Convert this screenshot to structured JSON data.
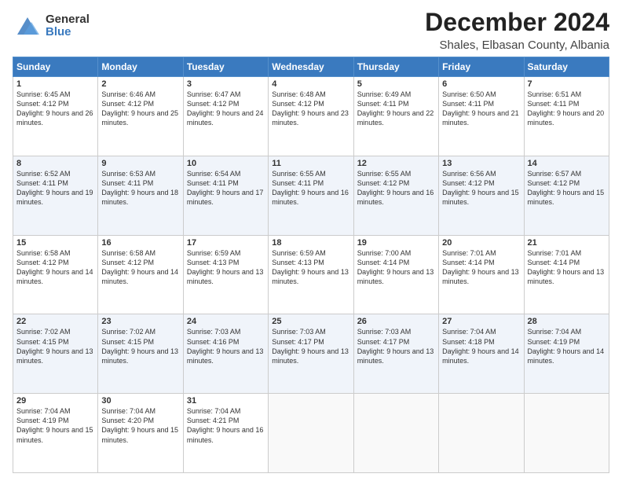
{
  "header": {
    "logo_general": "General",
    "logo_blue": "Blue",
    "title": "December 2024",
    "subtitle": "Shales, Elbasan County, Albania"
  },
  "columns": [
    "Sunday",
    "Monday",
    "Tuesday",
    "Wednesday",
    "Thursday",
    "Friday",
    "Saturday"
  ],
  "weeks": [
    [
      {
        "day": "1",
        "sunrise": "Sunrise: 6:45 AM",
        "sunset": "Sunset: 4:12 PM",
        "daylight": "Daylight: 9 hours and 26 minutes."
      },
      {
        "day": "2",
        "sunrise": "Sunrise: 6:46 AM",
        "sunset": "Sunset: 4:12 PM",
        "daylight": "Daylight: 9 hours and 25 minutes."
      },
      {
        "day": "3",
        "sunrise": "Sunrise: 6:47 AM",
        "sunset": "Sunset: 4:12 PM",
        "daylight": "Daylight: 9 hours and 24 minutes."
      },
      {
        "day": "4",
        "sunrise": "Sunrise: 6:48 AM",
        "sunset": "Sunset: 4:12 PM",
        "daylight": "Daylight: 9 hours and 23 minutes."
      },
      {
        "day": "5",
        "sunrise": "Sunrise: 6:49 AM",
        "sunset": "Sunset: 4:11 PM",
        "daylight": "Daylight: 9 hours and 22 minutes."
      },
      {
        "day": "6",
        "sunrise": "Sunrise: 6:50 AM",
        "sunset": "Sunset: 4:11 PM",
        "daylight": "Daylight: 9 hours and 21 minutes."
      },
      {
        "day": "7",
        "sunrise": "Sunrise: 6:51 AM",
        "sunset": "Sunset: 4:11 PM",
        "daylight": "Daylight: 9 hours and 20 minutes."
      }
    ],
    [
      {
        "day": "8",
        "sunrise": "Sunrise: 6:52 AM",
        "sunset": "Sunset: 4:11 PM",
        "daylight": "Daylight: 9 hours and 19 minutes."
      },
      {
        "day": "9",
        "sunrise": "Sunrise: 6:53 AM",
        "sunset": "Sunset: 4:11 PM",
        "daylight": "Daylight: 9 hours and 18 minutes."
      },
      {
        "day": "10",
        "sunrise": "Sunrise: 6:54 AM",
        "sunset": "Sunset: 4:11 PM",
        "daylight": "Daylight: 9 hours and 17 minutes."
      },
      {
        "day": "11",
        "sunrise": "Sunrise: 6:55 AM",
        "sunset": "Sunset: 4:11 PM",
        "daylight": "Daylight: 9 hours and 16 minutes."
      },
      {
        "day": "12",
        "sunrise": "Sunrise: 6:55 AM",
        "sunset": "Sunset: 4:12 PM",
        "daylight": "Daylight: 9 hours and 16 minutes."
      },
      {
        "day": "13",
        "sunrise": "Sunrise: 6:56 AM",
        "sunset": "Sunset: 4:12 PM",
        "daylight": "Daylight: 9 hours and 15 minutes."
      },
      {
        "day": "14",
        "sunrise": "Sunrise: 6:57 AM",
        "sunset": "Sunset: 4:12 PM",
        "daylight": "Daylight: 9 hours and 15 minutes."
      }
    ],
    [
      {
        "day": "15",
        "sunrise": "Sunrise: 6:58 AM",
        "sunset": "Sunset: 4:12 PM",
        "daylight": "Daylight: 9 hours and 14 minutes."
      },
      {
        "day": "16",
        "sunrise": "Sunrise: 6:58 AM",
        "sunset": "Sunset: 4:12 PM",
        "daylight": "Daylight: 9 hours and 14 minutes."
      },
      {
        "day": "17",
        "sunrise": "Sunrise: 6:59 AM",
        "sunset": "Sunset: 4:13 PM",
        "daylight": "Daylight: 9 hours and 13 minutes."
      },
      {
        "day": "18",
        "sunrise": "Sunrise: 6:59 AM",
        "sunset": "Sunset: 4:13 PM",
        "daylight": "Daylight: 9 hours and 13 minutes."
      },
      {
        "day": "19",
        "sunrise": "Sunrise: 7:00 AM",
        "sunset": "Sunset: 4:14 PM",
        "daylight": "Daylight: 9 hours and 13 minutes."
      },
      {
        "day": "20",
        "sunrise": "Sunrise: 7:01 AM",
        "sunset": "Sunset: 4:14 PM",
        "daylight": "Daylight: 9 hours and 13 minutes."
      },
      {
        "day": "21",
        "sunrise": "Sunrise: 7:01 AM",
        "sunset": "Sunset: 4:14 PM",
        "daylight": "Daylight: 9 hours and 13 minutes."
      }
    ],
    [
      {
        "day": "22",
        "sunrise": "Sunrise: 7:02 AM",
        "sunset": "Sunset: 4:15 PM",
        "daylight": "Daylight: 9 hours and 13 minutes."
      },
      {
        "day": "23",
        "sunrise": "Sunrise: 7:02 AM",
        "sunset": "Sunset: 4:15 PM",
        "daylight": "Daylight: 9 hours and 13 minutes."
      },
      {
        "day": "24",
        "sunrise": "Sunrise: 7:03 AM",
        "sunset": "Sunset: 4:16 PM",
        "daylight": "Daylight: 9 hours and 13 minutes."
      },
      {
        "day": "25",
        "sunrise": "Sunrise: 7:03 AM",
        "sunset": "Sunset: 4:17 PM",
        "daylight": "Daylight: 9 hours and 13 minutes."
      },
      {
        "day": "26",
        "sunrise": "Sunrise: 7:03 AM",
        "sunset": "Sunset: 4:17 PM",
        "daylight": "Daylight: 9 hours and 13 minutes."
      },
      {
        "day": "27",
        "sunrise": "Sunrise: 7:04 AM",
        "sunset": "Sunset: 4:18 PM",
        "daylight": "Daylight: 9 hours and 14 minutes."
      },
      {
        "day": "28",
        "sunrise": "Sunrise: 7:04 AM",
        "sunset": "Sunset: 4:19 PM",
        "daylight": "Daylight: 9 hours and 14 minutes."
      }
    ],
    [
      {
        "day": "29",
        "sunrise": "Sunrise: 7:04 AM",
        "sunset": "Sunset: 4:19 PM",
        "daylight": "Daylight: 9 hours and 15 minutes."
      },
      {
        "day": "30",
        "sunrise": "Sunrise: 7:04 AM",
        "sunset": "Sunset: 4:20 PM",
        "daylight": "Daylight: 9 hours and 15 minutes."
      },
      {
        "day": "31",
        "sunrise": "Sunrise: 7:04 AM",
        "sunset": "Sunset: 4:21 PM",
        "daylight": "Daylight: 9 hours and 16 minutes."
      },
      null,
      null,
      null,
      null
    ]
  ]
}
